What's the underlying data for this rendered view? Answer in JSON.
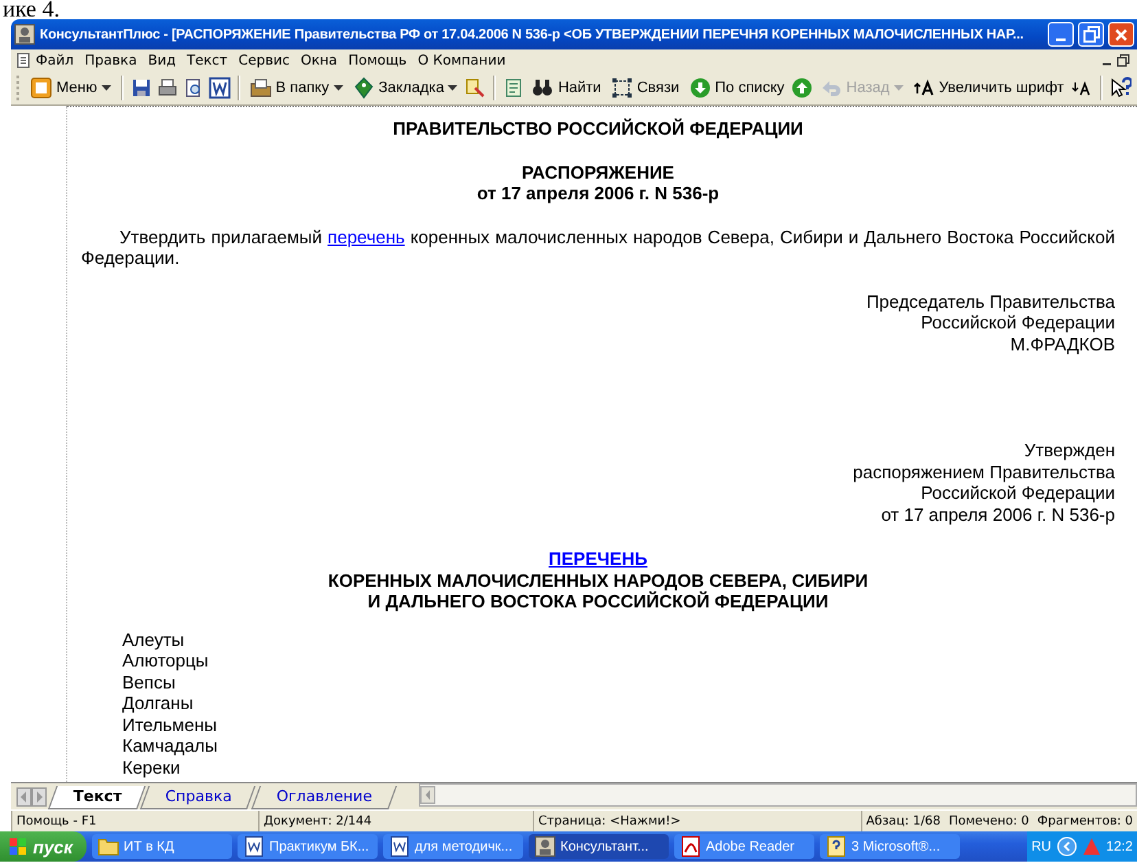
{
  "page_fragment": "ике 4.",
  "window": {
    "title": "КонсультантПлюс - [РАСПОРЯЖЕНИЕ Правительства РФ от 17.04.2006 N 536-р <ОБ УТВЕРЖДЕНИИ ПЕРЕЧНЯ КОРЕННЫХ МАЛОЧИСЛЕННЫХ НАР..."
  },
  "menu": [
    "Файл",
    "Правка",
    "Вид",
    "Текст",
    "Сервис",
    "Окна",
    "Помощь",
    "О Компании"
  ],
  "toolbar": [
    {
      "kind": "button",
      "label": "Меню",
      "dropdown": true,
      "disabled": false
    },
    {
      "kind": "separator"
    },
    {
      "kind": "icon",
      "disabled": false
    },
    {
      "kind": "icon",
      "disabled": false
    },
    {
      "kind": "icon",
      "disabled": false
    },
    {
      "kind": "icon",
      "disabled": false
    },
    {
      "kind": "separator"
    },
    {
      "kind": "button",
      "label": "В папку",
      "dropdown": true,
      "disabled": false
    },
    {
      "kind": "button",
      "label": "Закладка",
      "dropdown": true,
      "disabled": false
    },
    {
      "kind": "icon",
      "disabled": false
    },
    {
      "kind": "separator"
    },
    {
      "kind": "icon",
      "disabled": false
    },
    {
      "kind": "button",
      "label": "Найти",
      "dropdown": false,
      "disabled": false
    },
    {
      "kind": "button",
      "label": "Связи",
      "dropdown": false,
      "disabled": false
    },
    {
      "kind": "button",
      "label": "По списку",
      "dropdown": false,
      "disabled": false
    },
    {
      "kind": "icon",
      "disabled": false
    },
    {
      "kind": "button",
      "label": "Назад",
      "dropdown": true,
      "disabled": true
    },
    {
      "kind": "button",
      "label": "Увеличить шрифт",
      "dropdown": false,
      "disabled": false
    },
    {
      "kind": "icon",
      "disabled": false
    },
    {
      "kind": "separator"
    },
    {
      "kind": "icon",
      "disabled": false
    }
  ],
  "document": {
    "heading": "ПРАВИТЕЛЬСТВО РОССИЙСКОЙ ФЕДЕРАЦИИ",
    "doc_type": "РАСПОРЯЖЕНИЕ",
    "doc_date": "от 17 апреля 2006 г. N 536-р",
    "paragraph": {
      "before": "Утвердить прилагаемый",
      "link": "перечень",
      "after": "коренных малочисленных народов Севера, Сибири и Дальнего Востока Российской Федерации."
    },
    "signature": [
      "Председатель Правительства",
      "Российской Федерации",
      "М.ФРАДКОВ"
    ],
    "approval": [
      "Утвержден",
      "распоряжением Правительства",
      "Российской Федерации",
      "от 17 апреля 2006 г. N 536-р"
    ],
    "list_link": "ПЕРЕЧЕНЬ",
    "list_title": [
      "КОРЕННЫХ МАЛОЧИСЛЕННЫХ НАРОДОВ СЕВЕРА, СИБИРИ",
      "И ДАЛЬНЕГО ВОСТОКА РОССИЙСКОЙ ФЕДЕРАЦИИ"
    ],
    "peoples": [
      "Алеуты",
      "Алюторцы",
      "Вепсы",
      "Долганы",
      "Ительмены",
      "Камчадалы",
      "Кереки"
    ]
  },
  "tabs": [
    {
      "label": "Текст",
      "selected": true
    },
    {
      "label": "Справка",
      "selected": false
    },
    {
      "label": "Оглавление",
      "selected": false
    }
  ],
  "status_bar": [
    "Помощь - F1",
    "Документ: 2/144",
    "Страница: <Нажми!>",
    "Абзац: 1/68",
    "Помечено: 0",
    "Фрагментов: 0"
  ],
  "taskbar": {
    "start": "пуск",
    "items": [
      {
        "label": "ИТ в КД",
        "selected": false
      },
      {
        "label": "Практикум БК...",
        "selected": false
      },
      {
        "label": "для методичк...",
        "selected": false
      },
      {
        "label": "Консультант...",
        "selected": true
      },
      {
        "label": "Adobe Reader",
        "selected": false
      },
      {
        "label": "3 Microsoft®...",
        "selected": false
      }
    ],
    "language": "RU",
    "clock": "12:2"
  }
}
